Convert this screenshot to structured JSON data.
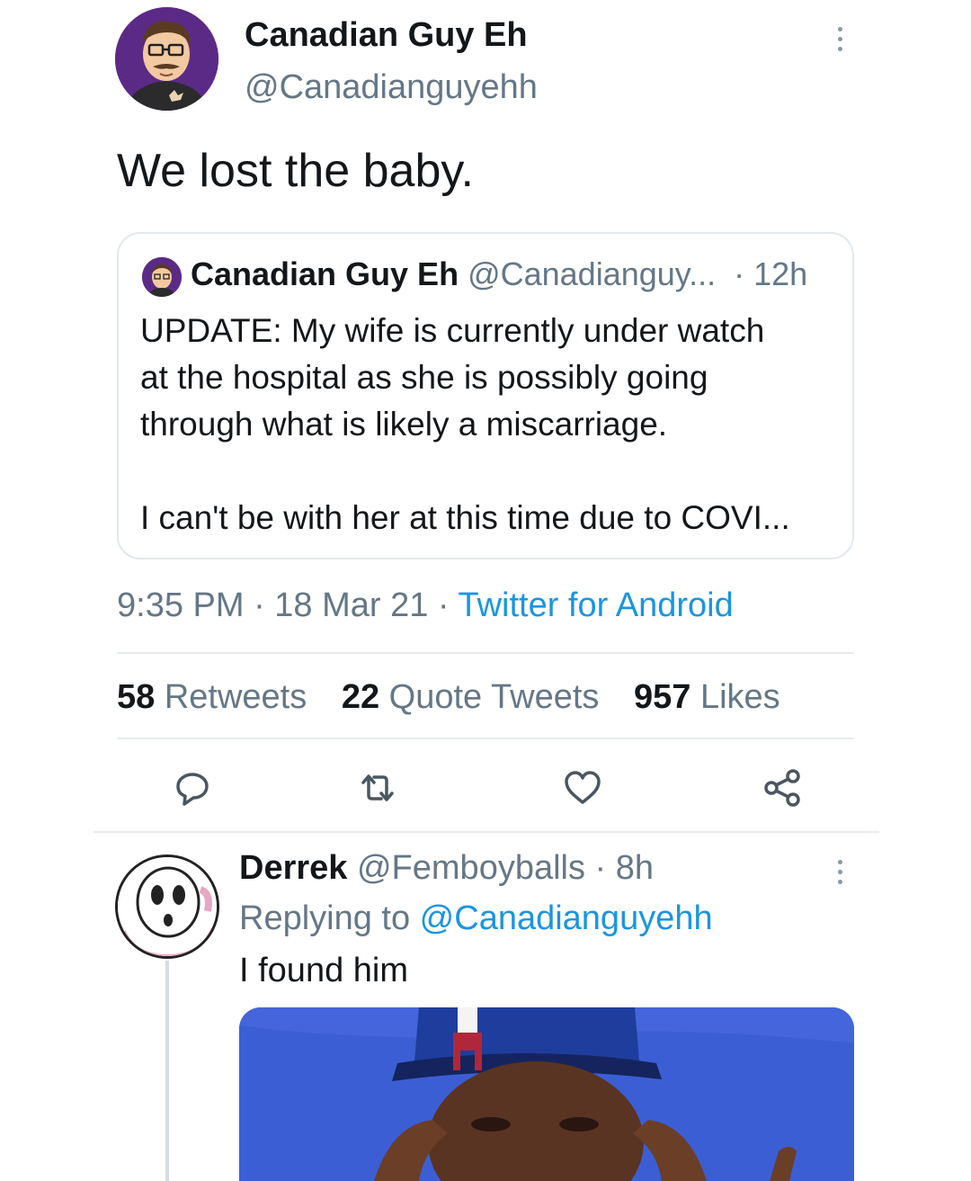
{
  "main_tweet": {
    "author_name": "Canadian Guy Eh",
    "author_handle": "@Canadianguyehh",
    "text": "We lost the baby.",
    "timestamp": "9:35 PM · 18 Mar 21 · ",
    "source": "Twitter for Android",
    "stats": {
      "retweets_count": "58",
      "retweets_label": " Retweets",
      "quotes_count": "22",
      "quotes_label": " Quote Tweets",
      "likes_count": "957",
      "likes_label": " Likes"
    },
    "actions": [
      "reply-icon",
      "retweet-icon",
      "like-icon",
      "share-icon"
    ]
  },
  "quoted_tweet": {
    "author_name": "Canadian Guy Eh",
    "author_handle": " @Canadianguy...",
    "time": "  · 12h",
    "lines": [
      "UPDATE: My wife is currently under watch",
      "at the hospital as she is possibly going",
      "through what is likely a miscarriage."
    ],
    "line2": "I can't be with her at this time due to COVI..."
  },
  "reply": {
    "author_name": "Derrek",
    "author_handle": " @Femboyballs",
    "time": " · 8h",
    "replying_prefix": "Replying to ",
    "replying_to": "@Canadianguyehh",
    "text": "I found him"
  },
  "colors": {
    "link": "#1b95e0",
    "secondary_text": "#657786",
    "primary_text": "#14171a",
    "divider": "#e6ecf0"
  }
}
